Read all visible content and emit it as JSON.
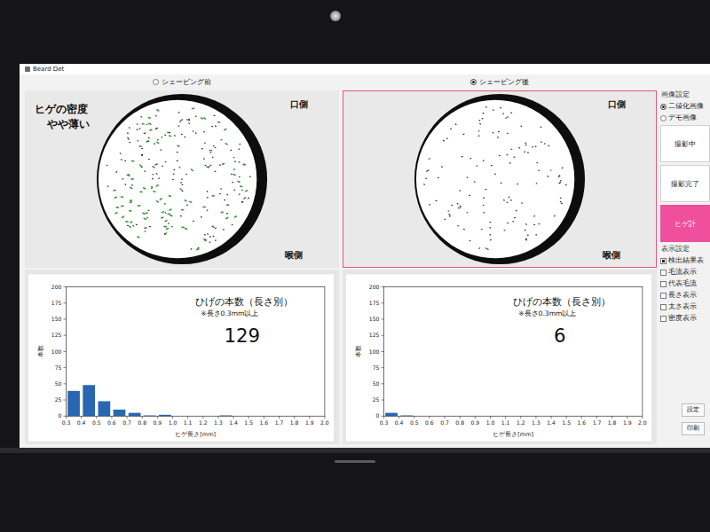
{
  "window": {
    "title": "Beard Det"
  },
  "panels": [
    {
      "view": {
        "label": "シェービング前",
        "selected": false
      },
      "image": {
        "density": {
          "title": "ヒゲの密度",
          "value": "やや薄い"
        },
        "mouth_label": "口側",
        "throat_label": "喉側",
        "detections_shown": true
      },
      "chart": {
        "title": "ひげの本数（長さ別）",
        "note": "※長さ0.3mm以上",
        "count": "129",
        "y_label": "本数",
        "x_label": "ヒゲ長さ[mm]",
        "y_ticks": [
          "0",
          "25",
          "50",
          "75",
          "100",
          "125",
          "150",
          "175",
          "200"
        ],
        "x_ticks": [
          "0.3",
          "0.4",
          "0.5",
          "0.6",
          "0.7",
          "0.8",
          "0.9",
          "1.0",
          "1.1",
          "1.2",
          "1.3",
          "1.4",
          "1.5",
          "1.6",
          "1.7",
          "1.8",
          "1.9",
          "2.0"
        ],
        "values": [
          39,
          48,
          23,
          10,
          5,
          1,
          2,
          0,
          0,
          0,
          1,
          0,
          0,
          0,
          0,
          0,
          0
        ]
      }
    },
    {
      "view": {
        "label": "シェービング後",
        "selected": true
      },
      "image": {
        "density": null,
        "mouth_label": "口側",
        "throat_label": "喉側",
        "detections_shown": false
      },
      "chart": {
        "title": "ひげの本数（長さ別）",
        "note": "※長さ0.3mm以上",
        "count": "6",
        "y_label": "本数",
        "x_label": "ヒゲ長さ[mm]",
        "y_ticks": [
          "0",
          "25",
          "50",
          "75",
          "100",
          "125",
          "150",
          "175",
          "200"
        ],
        "x_ticks": [
          "0.3",
          "0.4",
          "0.5",
          "0.6",
          "0.7",
          "0.8",
          "0.9",
          "1.0",
          "1.1",
          "1.2",
          "1.3",
          "1.4",
          "1.5",
          "1.6",
          "1.7",
          "1.8",
          "1.9",
          "2.0"
        ],
        "values": [
          5,
          1,
          0,
          0,
          0,
          0,
          0,
          0,
          0,
          0,
          0,
          0,
          0,
          0,
          0,
          0,
          0
        ]
      }
    }
  ],
  "sidebar": {
    "image_settings": {
      "title": "画像設定",
      "options": [
        {
          "label": "二値化画像",
          "selected": true
        },
        {
          "label": "デモ画像",
          "selected": false
        }
      ]
    },
    "buttons": [
      {
        "label": "撮影中",
        "primary": false
      },
      {
        "label": "撮影完了",
        "primary": false
      },
      {
        "label": "ヒゲ計",
        "primary": true
      }
    ],
    "display_settings": {
      "title": "表示設定",
      "options": [
        {
          "label": "検出結果表",
          "checked": true
        },
        {
          "label": "毛流表示",
          "checked": false
        },
        {
          "label": "代表毛流",
          "checked": false
        },
        {
          "label": "長さ表示",
          "checked": false
        },
        {
          "label": "太さ表示",
          "checked": false
        },
        {
          "label": "密度表示",
          "checked": false
        }
      ]
    },
    "small_buttons": [
      "設定",
      "印刷"
    ]
  }
}
